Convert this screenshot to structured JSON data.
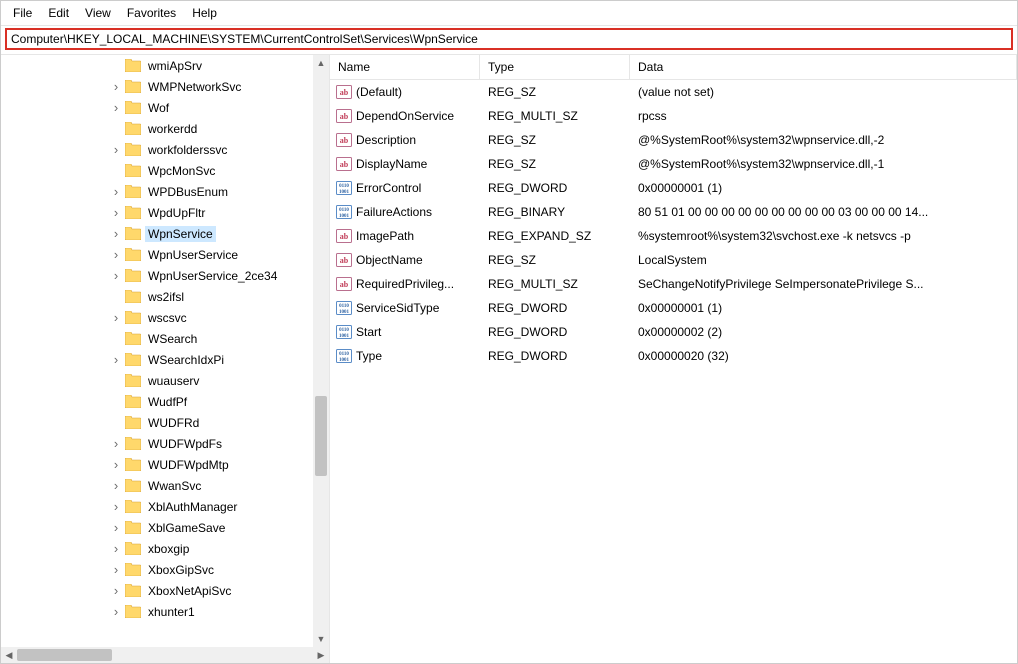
{
  "menubar": [
    "File",
    "Edit",
    "View",
    "Favorites",
    "Help"
  ],
  "address": "Computer\\HKEY_LOCAL_MACHINE\\SYSTEM\\CurrentControlSet\\Services\\WpnService",
  "tree": [
    {
      "label": "wmiApSrv",
      "expandable": false,
      "selected": false
    },
    {
      "label": "WMPNetworkSvc",
      "expandable": true,
      "selected": false
    },
    {
      "label": "Wof",
      "expandable": true,
      "selected": false
    },
    {
      "label": "workerdd",
      "expandable": false,
      "selected": false
    },
    {
      "label": "workfolderssvc",
      "expandable": true,
      "selected": false
    },
    {
      "label": "WpcMonSvc",
      "expandable": false,
      "selected": false
    },
    {
      "label": "WPDBusEnum",
      "expandable": true,
      "selected": false
    },
    {
      "label": "WpdUpFltr",
      "expandable": true,
      "selected": false
    },
    {
      "label": "WpnService",
      "expandable": true,
      "selected": true
    },
    {
      "label": "WpnUserService",
      "expandable": true,
      "selected": false
    },
    {
      "label": "WpnUserService_2ce34",
      "expandable": true,
      "selected": false
    },
    {
      "label": "ws2ifsl",
      "expandable": false,
      "selected": false
    },
    {
      "label": "wscsvc",
      "expandable": true,
      "selected": false
    },
    {
      "label": "WSearch",
      "expandable": false,
      "selected": false
    },
    {
      "label": "WSearchIdxPi",
      "expandable": true,
      "selected": false
    },
    {
      "label": "wuauserv",
      "expandable": false,
      "selected": false
    },
    {
      "label": "WudfPf",
      "expandable": false,
      "selected": false
    },
    {
      "label": "WUDFRd",
      "expandable": false,
      "selected": false
    },
    {
      "label": "WUDFWpdFs",
      "expandable": true,
      "selected": false
    },
    {
      "label": "WUDFWpdMtp",
      "expandable": true,
      "selected": false
    },
    {
      "label": "WwanSvc",
      "expandable": true,
      "selected": false
    },
    {
      "label": "XblAuthManager",
      "expandable": true,
      "selected": false
    },
    {
      "label": "XblGameSave",
      "expandable": true,
      "selected": false
    },
    {
      "label": "xboxgip",
      "expandable": true,
      "selected": false
    },
    {
      "label": "XboxGipSvc",
      "expandable": true,
      "selected": false
    },
    {
      "label": "XboxNetApiSvc",
      "expandable": true,
      "selected": false
    },
    {
      "label": "xhunter1",
      "expandable": true,
      "selected": false
    }
  ],
  "columns": {
    "name": "Name",
    "type": "Type",
    "data": "Data"
  },
  "values": [
    {
      "name": "(Default)",
      "type": "REG_SZ",
      "data": "(value not set)",
      "icon": "string"
    },
    {
      "name": "DependOnService",
      "type": "REG_MULTI_SZ",
      "data": "rpcss",
      "icon": "string"
    },
    {
      "name": "Description",
      "type": "REG_SZ",
      "data": "@%SystemRoot%\\system32\\wpnservice.dll,-2",
      "icon": "string"
    },
    {
      "name": "DisplayName",
      "type": "REG_SZ",
      "data": "@%SystemRoot%\\system32\\wpnservice.dll,-1",
      "icon": "string"
    },
    {
      "name": "ErrorControl",
      "type": "REG_DWORD",
      "data": "0x00000001 (1)",
      "icon": "binary"
    },
    {
      "name": "FailureActions",
      "type": "REG_BINARY",
      "data": "80 51 01 00 00 00 00 00 00 00 00 00 03 00 00 00 14...",
      "icon": "binary"
    },
    {
      "name": "ImagePath",
      "type": "REG_EXPAND_SZ",
      "data": "%systemroot%\\system32\\svchost.exe -k netsvcs -p",
      "icon": "string"
    },
    {
      "name": "ObjectName",
      "type": "REG_SZ",
      "data": "LocalSystem",
      "icon": "string"
    },
    {
      "name": "RequiredPrivileg...",
      "type": "REG_MULTI_SZ",
      "data": "SeChangeNotifyPrivilege SeImpersonatePrivilege S...",
      "icon": "string"
    },
    {
      "name": "ServiceSidType",
      "type": "REG_DWORD",
      "data": "0x00000001 (1)",
      "icon": "binary"
    },
    {
      "name": "Start",
      "type": "REG_DWORD",
      "data": "0x00000002 (2)",
      "icon": "binary"
    },
    {
      "name": "Type",
      "type": "REG_DWORD",
      "data": "0x00000020 (32)",
      "icon": "binary"
    }
  ],
  "glyph": {
    "expand": "›",
    "up": "▲",
    "down": "▼",
    "left": "◀",
    "right": "▶"
  }
}
